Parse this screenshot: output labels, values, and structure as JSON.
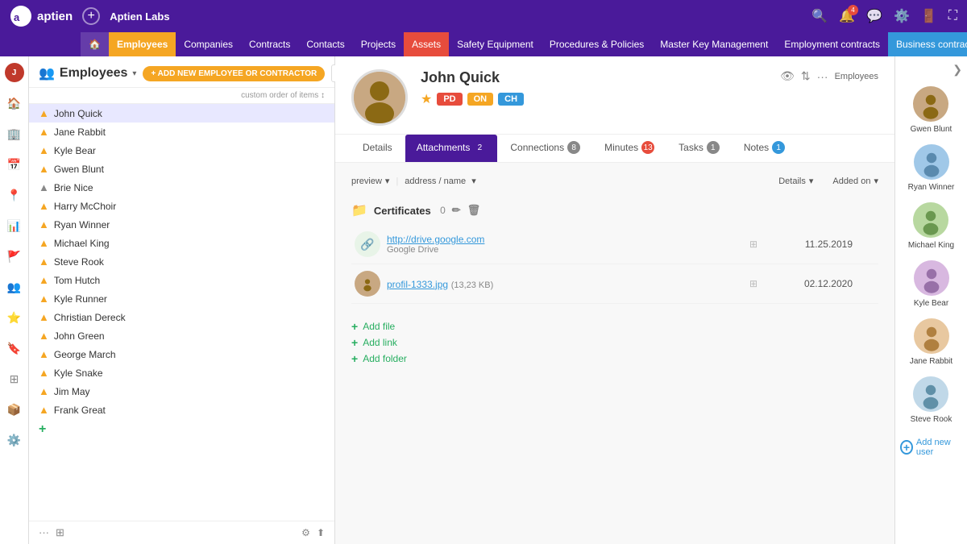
{
  "app": {
    "logo_text": "aptien",
    "company_name": "Aptien Labs"
  },
  "top_nav": {
    "add_icon": "+",
    "icons": [
      "search",
      "notifications",
      "chat",
      "settings",
      "logout",
      "fullscreen"
    ],
    "notification_count": "4"
  },
  "tab_nav": {
    "items": [
      {
        "label": "🏠",
        "key": "home",
        "class": "home"
      },
      {
        "label": "Employees",
        "key": "employees",
        "class": "active"
      },
      {
        "label": "Companies",
        "key": "companies",
        "class": ""
      },
      {
        "label": "Contracts",
        "key": "contracts",
        "class": ""
      },
      {
        "label": "Contacts",
        "key": "contacts",
        "class": ""
      },
      {
        "label": "Projects",
        "key": "projects",
        "class": ""
      },
      {
        "label": "Assets",
        "key": "assets",
        "class": "tab-assets"
      },
      {
        "label": "Safety Equipment",
        "key": "safety",
        "class": ""
      },
      {
        "label": "Procedures & Policies",
        "key": "procedures",
        "class": ""
      },
      {
        "label": "Master Key Management",
        "key": "master-key",
        "class": ""
      },
      {
        "label": "Employment contracts",
        "key": "employment",
        "class": ""
      },
      {
        "label": "Business contracts",
        "key": "business",
        "class": "tab-business"
      }
    ]
  },
  "employee_section": {
    "title": "Employees",
    "add_button": "+ ADD NEW EMPLOYEE OR CONTRACTOR",
    "search_placeholder": "",
    "custom_order_label": "custom order of items",
    "employees": [
      {
        "name": "John Quick",
        "icon": "yellow",
        "selected": true
      },
      {
        "name": "Jane Rabbit",
        "icon": "yellow",
        "selected": false
      },
      {
        "name": "Kyle Bear",
        "icon": "yellow",
        "selected": false
      },
      {
        "name": "Gwen Blunt",
        "icon": "yellow",
        "selected": false
      },
      {
        "name": "Brie Nice",
        "icon": "grey",
        "selected": false
      },
      {
        "name": "Harry McChoir",
        "icon": "yellow",
        "selected": false
      },
      {
        "name": "Ryan Winner",
        "icon": "yellow",
        "selected": false
      },
      {
        "name": "Michael King",
        "icon": "yellow",
        "selected": false
      },
      {
        "name": "Steve Rook",
        "icon": "yellow",
        "selected": false
      },
      {
        "name": "Tom Hutch",
        "icon": "yellow",
        "selected": false
      },
      {
        "name": "Kyle Runner",
        "icon": "yellow",
        "selected": false
      },
      {
        "name": "Christian Dereck",
        "icon": "yellow",
        "selected": false
      },
      {
        "name": "John Green",
        "icon": "yellow",
        "selected": false
      },
      {
        "name": "George March",
        "icon": "yellow",
        "selected": false
      },
      {
        "name": "Kyle Snake",
        "icon": "yellow",
        "selected": false
      },
      {
        "name": "Jim May",
        "icon": "yellow",
        "selected": false
      },
      {
        "name": "Frank Great",
        "icon": "yellow",
        "selected": false
      }
    ]
  },
  "detail": {
    "name": "John Quick",
    "label": "Employees",
    "badges": [
      "★",
      "PD",
      "ON",
      "CH"
    ],
    "tabs": [
      {
        "label": "Details",
        "key": "details",
        "count": null,
        "active": false
      },
      {
        "label": "Attachments",
        "key": "attachments",
        "count": "2",
        "active": true
      },
      {
        "label": "Connections",
        "key": "connections",
        "count": "8",
        "active": false
      },
      {
        "label": "Minutes",
        "key": "minutes",
        "count": "13",
        "active": false
      },
      {
        "label": "Tasks",
        "key": "tasks",
        "count": "1",
        "active": false
      },
      {
        "label": "Notes",
        "key": "notes",
        "count": "1",
        "active": false
      }
    ],
    "attachments": {
      "toolbar": {
        "preview_label": "preview",
        "address_label": "address / name",
        "details_label": "Details",
        "added_on_label": "Added on"
      },
      "certificates": {
        "title": "Certificates",
        "count": "0",
        "items": [
          {
            "type": "link",
            "url": "http://drive.google.com",
            "subtitle": "Google Drive",
            "date": "11.25.2019"
          },
          {
            "type": "file",
            "url": "profil-1333.jpg",
            "size": "(13,23 KB)",
            "date": "02.12.2020"
          }
        ]
      },
      "add_actions": [
        {
          "label": "Add file"
        },
        {
          "label": "Add link"
        },
        {
          "label": "Add folder"
        }
      ]
    }
  },
  "right_panel": {
    "users": [
      {
        "name": "Gwen Blunt",
        "avatar": "👤"
      },
      {
        "name": "Ryan Winner",
        "avatar": "👤"
      },
      {
        "name": "Michael King",
        "avatar": "👤"
      },
      {
        "name": "Kyle Bear",
        "avatar": "👤"
      },
      {
        "name": "Jane Rabbit",
        "avatar": "👤"
      },
      {
        "name": "Steve Rook",
        "avatar": "👤"
      }
    ],
    "add_user_label": "Add new user"
  }
}
